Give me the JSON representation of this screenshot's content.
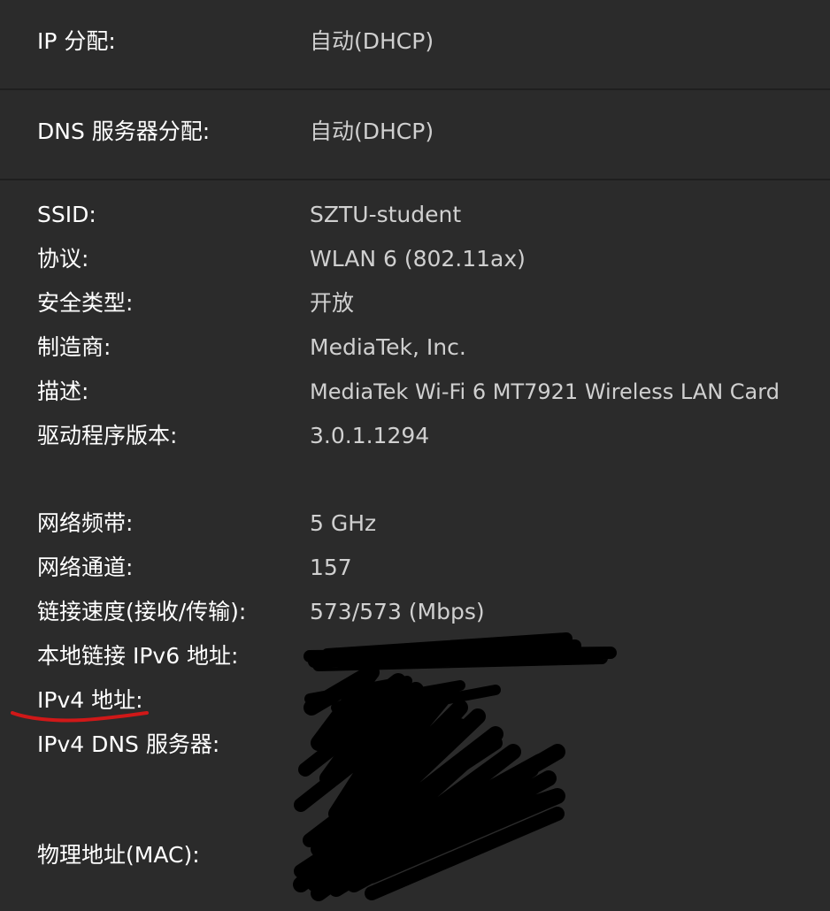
{
  "colors": {
    "background": "#2b2b2b",
    "label": "#ffffff",
    "value": "#d0d0d0",
    "underline": "#d01818",
    "redaction": "#000000"
  },
  "ip_settings": [
    {
      "label": "IP 分配:",
      "value": "自动(DHCP)"
    },
    {
      "label": "DNS 服务器分配:",
      "value": "自动(DHCP)"
    }
  ],
  "properties_group1": [
    {
      "label": "SSID:",
      "value": "SZTU-student"
    },
    {
      "label": "协议:",
      "value": "WLAN 6 (802.11ax)"
    },
    {
      "label": "安全类型:",
      "value": "开放"
    },
    {
      "label": "制造商:",
      "value": "MediaTek, Inc."
    },
    {
      "label": "描述:",
      "value": "MediaTek Wi-Fi 6 MT7921 Wireless LAN Card"
    },
    {
      "label": "驱动程序版本:",
      "value": "3.0.1.1294"
    }
  ],
  "properties_group2": [
    {
      "label": "网络频带:",
      "value": "5 GHz"
    },
    {
      "label": "网络通道:",
      "value": "157"
    },
    {
      "label": "链接速度(接收/传输):",
      "value": "573/573 (Mbps)"
    },
    {
      "label": "本地链接 IPv6 地址:"
    },
    {
      "label": "IPv4 地址:"
    },
    {
      "label": "IPv4 DNS 服务器:"
    },
    {
      "label": "物理地址(MAC):"
    }
  ]
}
